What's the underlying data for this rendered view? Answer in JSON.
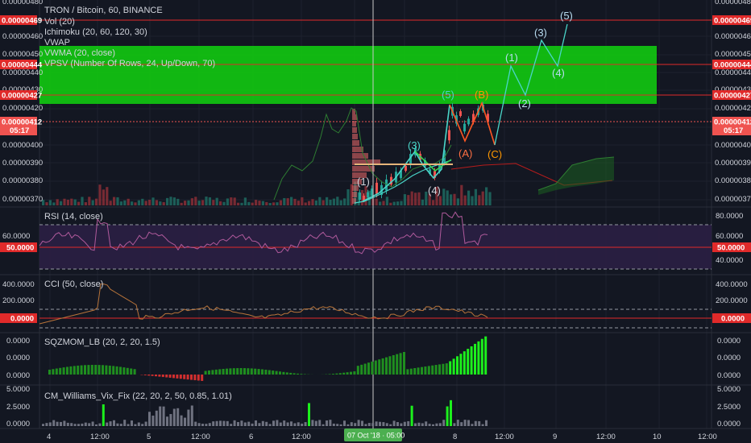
{
  "header": {
    "symbol_line": "TRON / Bitcoin, 60, BINANCE",
    "indicators": [
      "Vol (20)",
      "Ichimoku (20, 60, 120, 30)",
      "VWAP",
      "VWMA (20, close)",
      "VPSV (Number Of Rows, 24, Up/Down, 70)"
    ]
  },
  "price_axis": {
    "labels": [
      "0.00000370",
      "0.00000380",
      "0.00000390",
      "0.00000400",
      "0.00000420",
      "0.00000430",
      "0.00000440",
      "0.00000450",
      "0.00000460"
    ],
    "top_cut_label": "0.00000480",
    "left_tags": [
      {
        "text": "0.00000469",
        "color": "#ef3b3b"
      },
      {
        "text": "0.00000444",
        "color": "#ef3b3b"
      },
      {
        "text": "0.00000427",
        "color": "#ef3b3b"
      },
      {
        "text": "0.00000412",
        "color": "#ef5350"
      }
    ],
    "right_tags": [
      {
        "text": "0.00000469",
        "color": "#ef3b3b"
      },
      {
        "text": "0.00000444",
        "color": "#ef3b3b"
      },
      {
        "text": "0.00000427",
        "color": "#ef3b3b"
      },
      {
        "text": "0.00000412",
        "color": "#ef5350"
      }
    ],
    "countdown": "05:17"
  },
  "rsi": {
    "title": "RSI (14, close)",
    "labels": [
      "80.0000",
      "60.0000",
      "40.0000"
    ],
    "tag": "50.0000"
  },
  "cci": {
    "title": "CCI (50, close)",
    "labels": [
      "400.0000",
      "200.0000"
    ],
    "tag": "0.0000"
  },
  "sqz": {
    "title": "SQZMOM_LB (20, 2, 20, 1.5)",
    "labels": [
      "0.0000",
      "0.0000",
      "0.0000"
    ]
  },
  "cmw": {
    "title": "CM_Williams_Vix_Fix (22, 20, 2, 50, 0.85, 1.01)",
    "labels": [
      "5.0000",
      "2.5000",
      "0.0000"
    ]
  },
  "time_axis": {
    "labels": [
      "4",
      "12:00",
      "5",
      "12:00",
      "6",
      "12:00",
      "8",
      "12:00",
      "9",
      "12:00",
      "10",
      "12:00"
    ],
    "cursor_label": "07 Oct '18 · 05:00"
  },
  "waves": {
    "impulse_small": [
      "(1)",
      "(3)",
      "(4)",
      "(5)"
    ],
    "correction": [
      "(A)",
      "(B)",
      "(C)"
    ],
    "projection": [
      "(1)",
      "(2)",
      "(3)",
      "(4)",
      "(5)"
    ]
  },
  "colors": {
    "background": "#131722",
    "zone_green": "#11c611",
    "level_red": "#e02a2a",
    "up": "#26a69a",
    "down": "#ef5350",
    "rsi_band": "#2b1f44",
    "wave_teal": "#4ad5c9",
    "wave_orange": "#ff9800",
    "projection": "#9ec8e0"
  }
}
